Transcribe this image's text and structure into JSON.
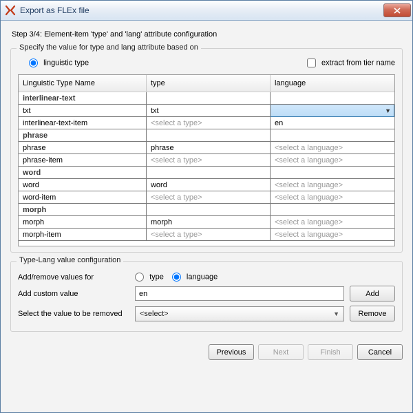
{
  "window": {
    "title": "Export as FLEx file"
  },
  "step_label": "Step 3/4: Element-item 'type' and 'lang' attribute configuration",
  "panel1": {
    "legend": "Specify the value for type and lang attribute based on",
    "radio_linguistic_label": "linguistic type",
    "checkbox_extract_label": "extract from tier name"
  },
  "table": {
    "headers": {
      "name": "Linguistic Type Name",
      "type": "type",
      "lang": "language"
    },
    "placeholder_type": "<select a type>",
    "placeholder_lang": "<select a language>",
    "groups": [
      {
        "group": "interlinear-text",
        "rows": [
          {
            "name": "txt",
            "type": "txt",
            "lang": "",
            "lang_active": true
          },
          {
            "name": "interlinear-text-item",
            "type": "",
            "lang": "en"
          }
        ]
      },
      {
        "group": "phrase",
        "rows": [
          {
            "name": "phrase",
            "type": "phrase",
            "lang": ""
          },
          {
            "name": "phrase-item",
            "type": "",
            "lang": ""
          }
        ]
      },
      {
        "group": "word",
        "rows": [
          {
            "name": "word",
            "type": "word",
            "lang": ""
          },
          {
            "name": "word-item",
            "type": "",
            "lang": ""
          }
        ]
      },
      {
        "group": "morph",
        "rows": [
          {
            "name": "morph",
            "type": "morph",
            "lang": ""
          },
          {
            "name": "morph-item",
            "type": "",
            "lang": ""
          }
        ]
      }
    ]
  },
  "panel2": {
    "legend": "Type-Lang value configuration",
    "addremove_label": "Add/remove values for",
    "radio_type_label": "type",
    "radio_lang_label": "language",
    "custom_label": "Add custom value",
    "custom_value": "en",
    "remove_label": "Select the value to be removed",
    "remove_select_value": "<select>",
    "add_btn": "Add",
    "remove_btn": "Remove"
  },
  "footer": {
    "prev": "Previous",
    "next": "Next",
    "finish": "Finish",
    "cancel": "Cancel"
  }
}
